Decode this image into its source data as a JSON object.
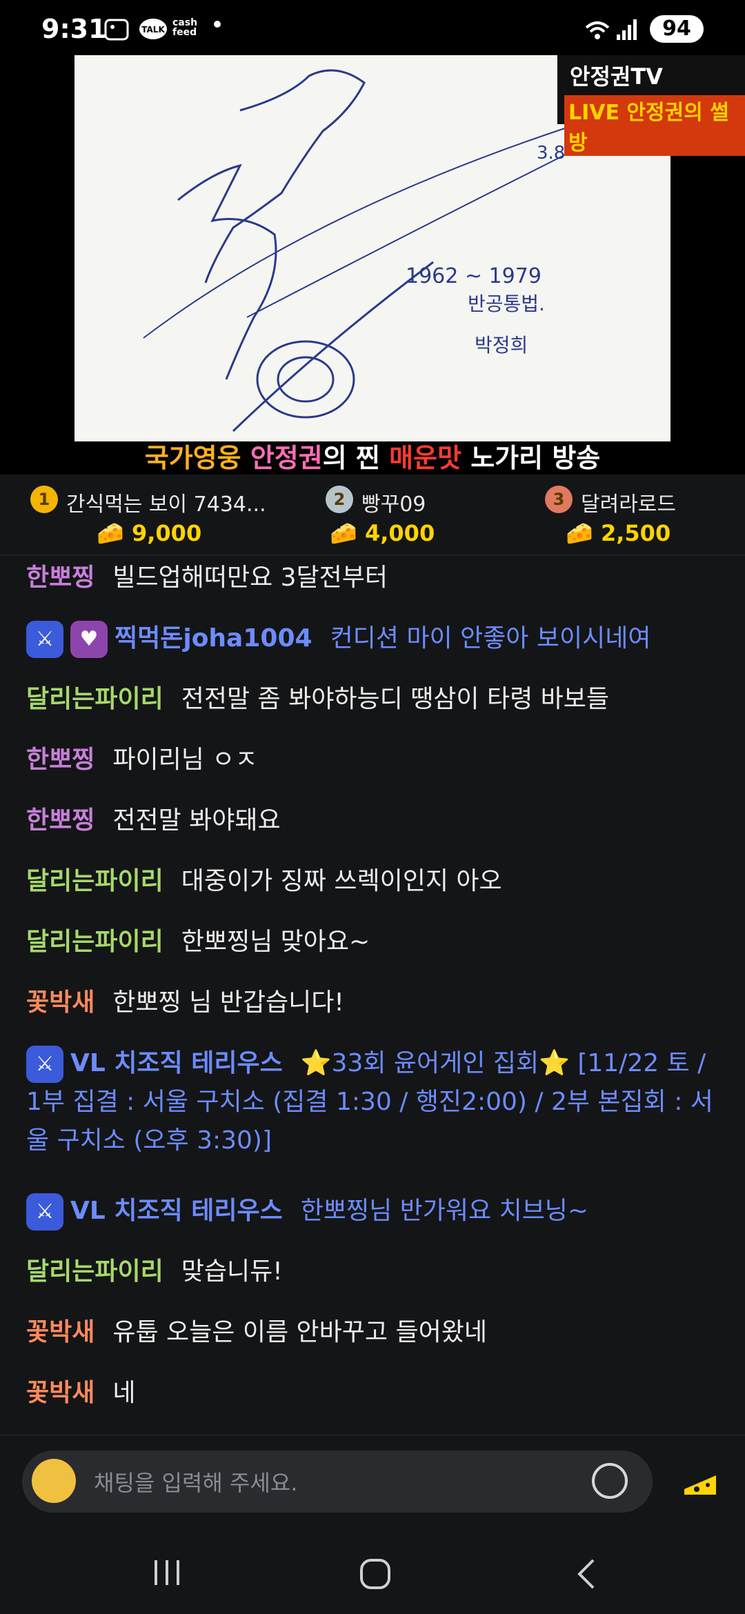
{
  "status_bar": {
    "time": "9:31",
    "battery": "94",
    "icons": [
      "gallery-icon",
      "talk-icon",
      "cashfeed-icon",
      "dot-icon",
      "wifi-icon",
      "signal-icon",
      "battery-icon"
    ],
    "talk_label": "TALK",
    "cash_label": "cash\nfeed"
  },
  "stream": {
    "logo_title": "안정권TV",
    "logo_live": "LIVE 안정권의 썰방",
    "banner": {
      "part1": "국가영웅 ",
      "part2": "안정권",
      "part3": "의 찐 ",
      "part4": "매운맛",
      "part5": " 노가리 방송"
    },
    "board_text": [
      "1962 ~ 1979",
      "반공통법.",
      "박정희",
      "3.8"
    ]
  },
  "ranking": [
    {
      "rank": "1",
      "name": "간식먹는 보이 7434...",
      "score": "9,000",
      "color": "#f5b400"
    },
    {
      "rank": "2",
      "name": "빵꾸09",
      "score": "4,000",
      "color": "#b8c4cc"
    },
    {
      "rank": "3",
      "name": "달려라로드",
      "score": "2,500",
      "color": "#e07a5f"
    }
  ],
  "chat": [
    {
      "user": "한뽀찡",
      "text": "빌드업해떠만요 3달전부터",
      "user_color": "#c780d9",
      "text_color": "#ececec"
    },
    {
      "user": "찍먹돈joha1004",
      "text": "컨디션 마이 안좋아 보이시네여",
      "user_color": "#6c8cff",
      "text_color": "#6c8cff",
      "badges": [
        "sword",
        "heart"
      ]
    },
    {
      "user": "달리는파이리",
      "text": "전전말 좀 봐야하능디 땡삼이 타령 바보들",
      "user_color": "#a6d96a",
      "text_color": "#ececec"
    },
    {
      "user": "한뽀찡",
      "text": "파이리님 ㅇㅈ",
      "user_color": "#c780d9",
      "text_color": "#ececec"
    },
    {
      "user": "한뽀찡",
      "text": "전전말 봐야돼요",
      "user_color": "#c780d9",
      "text_color": "#ececec"
    },
    {
      "user": "달리는파이리",
      "text": "대중이가 징짜 쓰렉이인지 아오",
      "user_color": "#a6d96a",
      "text_color": "#ececec"
    },
    {
      "user": "달리는파이리",
      "text": "한뽀찡님 맞아요~",
      "user_color": "#a6d96a",
      "text_color": "#ececec"
    },
    {
      "user": "꽃박새",
      "text": "한뽀찡 님 반갑습니다!",
      "user_color": "#ff8a5c",
      "text_color": "#ececec"
    },
    {
      "user": "VL 치조직 테리우스",
      "text": "⭐33회 윤어게인 집회⭐ [11/22 토 / 1부 집결 : 서울 구치소 (집결 1:30 / 행진2:00) / 2부 본집회 : 서울 구치소 (오후 3:30)]",
      "user_color": "#6c8cff",
      "text_color": "#6c8cff",
      "badges": [
        "sword"
      ]
    },
    {
      "user": "VL 치조직 테리우스",
      "text": "한뽀찡님 반가워요 치브닝~",
      "user_color": "#6c8cff",
      "text_color": "#6c8cff",
      "badges": [
        "sword"
      ]
    },
    {
      "user": "달리는파이리",
      "text": "맞습니듀!",
      "user_color": "#a6d96a",
      "text_color": "#ececec"
    },
    {
      "user": "꽃박새",
      "text": "유툽 오늘은 이름 안바꾸고 들어왔네",
      "user_color": "#ff8a5c",
      "text_color": "#ececec"
    },
    {
      "user": "꽃박새",
      "text": "네",
      "user_color": "#ff8a5c",
      "text_color": "#ececec"
    }
  ],
  "input": {
    "placeholder": "채팅을 입력해 주세요."
  },
  "nav": {
    "icons": [
      "recents-icon",
      "home-icon",
      "back-icon"
    ]
  }
}
